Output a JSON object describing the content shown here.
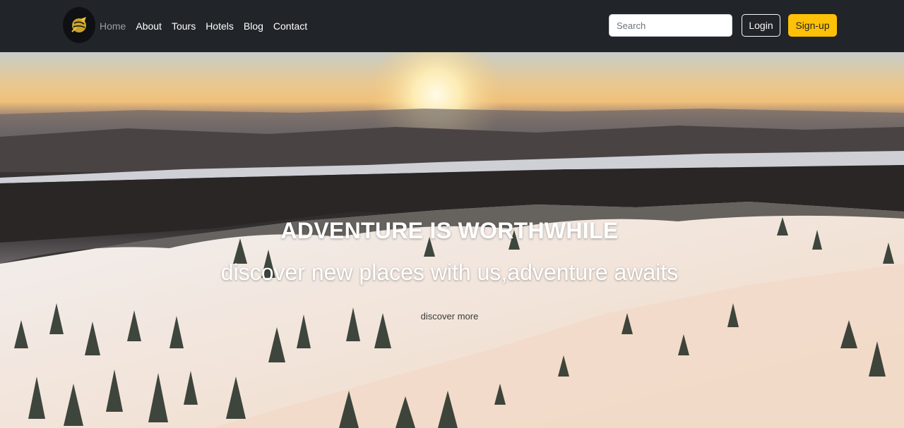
{
  "navbar": {
    "logo_icon": "rocket-globe-logo-icon",
    "links": [
      {
        "label": "Home",
        "active": true
      },
      {
        "label": "About",
        "active": false
      },
      {
        "label": "Tours",
        "active": false
      },
      {
        "label": "Hotels",
        "active": false
      },
      {
        "label": "Blog",
        "active": false
      },
      {
        "label": "Contact",
        "active": false
      }
    ],
    "search": {
      "placeholder": "Search",
      "value": ""
    },
    "login_label": "Login",
    "signup_label": "Sign-up"
  },
  "hero": {
    "title": "ADVENTURE IS WORTHWHILE",
    "subtitle": "discover new places with us,adventure awaits",
    "link_label": "discover more"
  },
  "colors": {
    "navbar_bg": "#212529",
    "accent": "#ffc107",
    "active_link": "rgba(255,255,255,0.55)"
  }
}
